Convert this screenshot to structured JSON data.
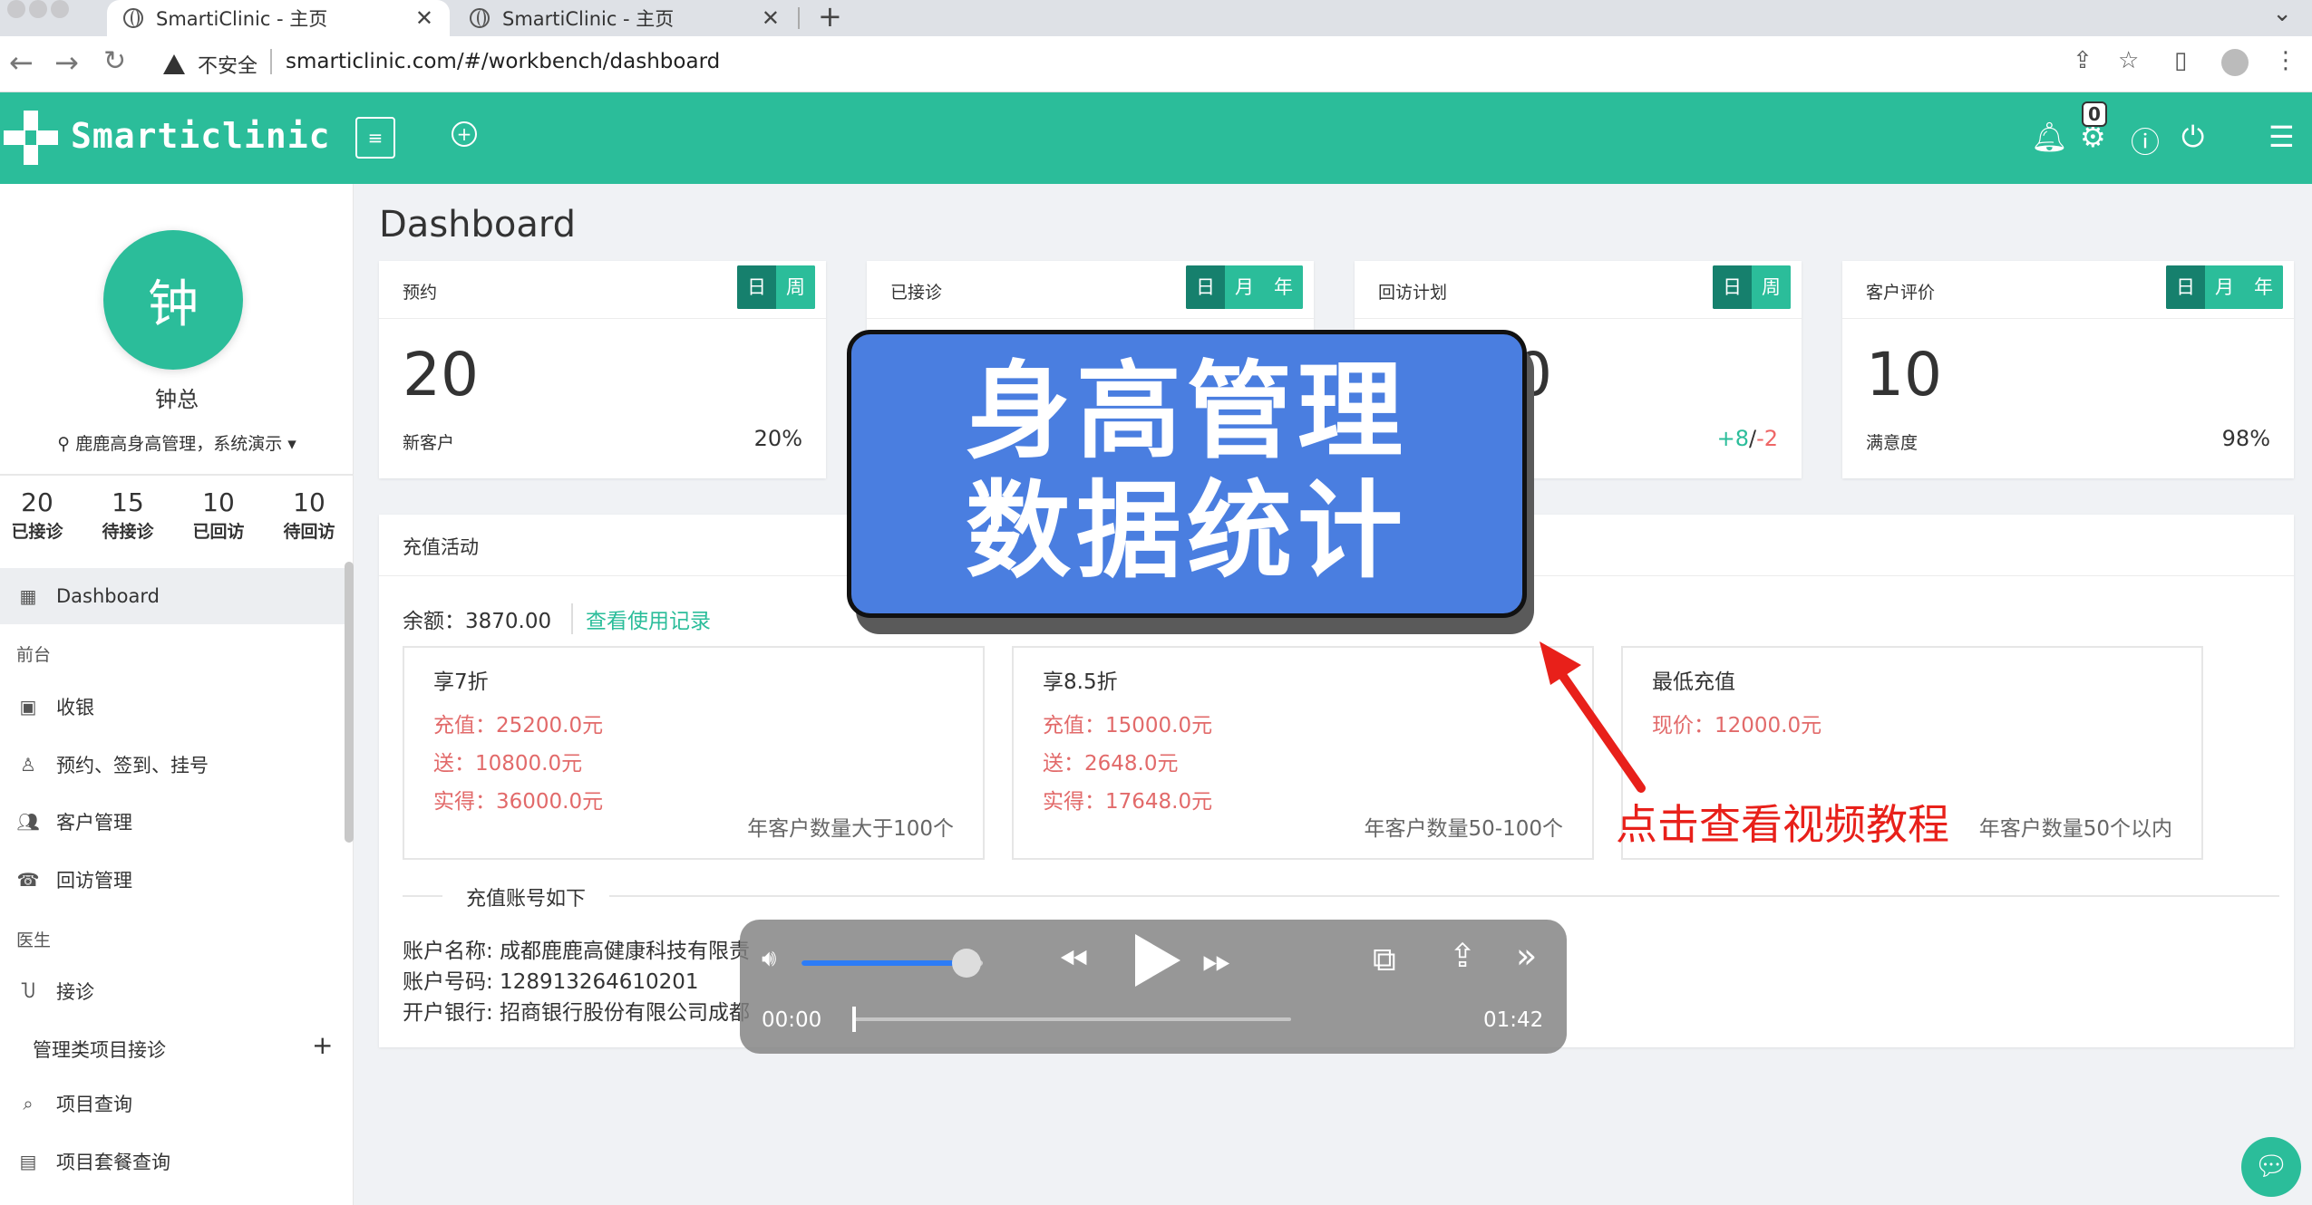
{
  "browser": {
    "tabs": [
      {
        "title": "SmartiClinic - 主页",
        "active": true
      },
      {
        "title": "SmartiClinic - 主页",
        "active": false
      }
    ],
    "security_label": "不安全",
    "url": "smarticlinic.com/#/workbench/dashboard"
  },
  "header": {
    "brand": "Smarticlinic",
    "notification_count": "0",
    "accent_color": "#2bbd9a"
  },
  "sidebar": {
    "avatar_char": "钟",
    "user_name": "钟总",
    "org": "鹿鹿高身高管理，系统演示",
    "stats": [
      {
        "value": "20",
        "label": "已接诊"
      },
      {
        "value": "15",
        "label": "待接诊"
      },
      {
        "value": "10",
        "label": "已回访"
      },
      {
        "value": "10",
        "label": "待回访"
      }
    ],
    "menu": {
      "dashboard": "Dashboard",
      "section_front": "前台",
      "cashier": "收银",
      "appointment": "预约、签到、挂号",
      "customers": "客户管理",
      "followup": "回访管理",
      "section_doctor": "医生",
      "consult": "接诊",
      "project_consult": "管理类项目接诊",
      "project_query": "项目查询",
      "package_query": "项目套餐查询"
    }
  },
  "main": {
    "title": "Dashboard",
    "cards": [
      {
        "title": "预约",
        "segments": [
          "日",
          "周"
        ],
        "value": "20",
        "sub": "新客户",
        "right": "20%"
      },
      {
        "title": "已接诊",
        "segments": [
          "日",
          "月",
          "年"
        ],
        "value": "",
        "sub": "",
        "right": ""
      },
      {
        "title": "回访计划",
        "segments": [
          "日",
          "周"
        ],
        "value": "0",
        "sub": "",
        "right_pos": "+8",
        "right_sep": "/",
        "right_neg": "-2"
      },
      {
        "title": "客户评价",
        "segments": [
          "日",
          "月",
          "年"
        ],
        "value": "10",
        "sub": "满意度",
        "right": "98%"
      }
    ],
    "recharge": {
      "title": "充值活动",
      "balance_label": "余额：",
      "balance_value": "3870.00",
      "history_link": "查看使用记录",
      "plans": [
        {
          "title": "享7折",
          "lines": [
            "充值：25200.0元",
            "送：10800.0元",
            "实得：36000.0元"
          ],
          "note": "年客户数量大于100个"
        },
        {
          "title": "享8.5折",
          "lines": [
            "充值：15000.0元",
            "送：2648.0元",
            "实得：17648.0元"
          ],
          "note": "年客户数量50-100个"
        },
        {
          "title": "最低充值",
          "lines": [
            "现价：12000.0元"
          ],
          "note": "年客户数量50个以内"
        }
      ],
      "account_title": "充值账号如下",
      "account_lines": [
        "账户名称: 成都鹿鹿高健康科技有限责",
        "账户号码: 128913264610201",
        "开户银行: 招商银行股份有限公司成都"
      ]
    }
  },
  "overlay": {
    "banner_line1": "身高管理",
    "banner_line2": "数据统计",
    "tutorial": "点击查看视频教程",
    "player": {
      "current_time": "00:00",
      "duration": "01:42",
      "volume_fraction": 0.85,
      "progress_fraction": 0.0
    }
  }
}
